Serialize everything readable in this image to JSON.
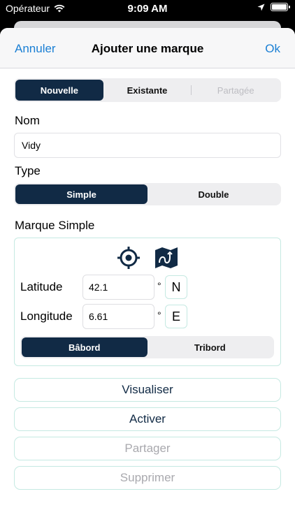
{
  "status_bar": {
    "carrier": "Opérateur",
    "time": "9:09 AM"
  },
  "nav": {
    "cancel": "Annuler",
    "title": "Ajouter une marque",
    "ok": "Ok"
  },
  "source_segment": {
    "options": [
      "Nouvelle",
      "Existante",
      "Partagée"
    ],
    "selected": "Nouvelle"
  },
  "name": {
    "label": "Nom",
    "value": "Vidy"
  },
  "type": {
    "label": "Type",
    "options": [
      "Simple",
      "Double"
    ],
    "selected": "Simple"
  },
  "mark": {
    "section_title": "Marque Simple",
    "latitude": {
      "label": "Latitude",
      "value": "42.1",
      "degree": "°",
      "hemisphere": "N"
    },
    "longitude": {
      "label": "Longitude",
      "value": "6.61",
      "degree": "°",
      "hemisphere": "E"
    },
    "side": {
      "options": [
        "Bâbord",
        "Tribord"
      ],
      "selected": "Bâbord"
    }
  },
  "actions": {
    "visualize": "Visualiser",
    "activate": "Activer",
    "share": "Partager",
    "delete": "Supprimer"
  },
  "colors": {
    "accent": "#1a7fd4",
    "dark": "#112a45",
    "border": "#c5e9e2"
  }
}
